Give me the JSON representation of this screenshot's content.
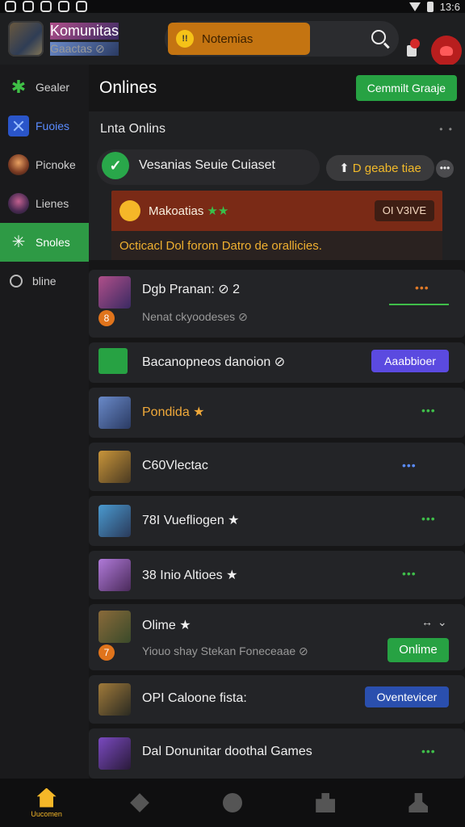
{
  "status": {
    "time": "13:6"
  },
  "header": {
    "app_name": "Komunitas",
    "app_sub": "Gaactas ⊘",
    "notif_label": "Notemias",
    "notif_icon": "!!"
  },
  "sidebar": {
    "items": [
      {
        "label": "Gealer",
        "icon": "star-icon"
      },
      {
        "label": "Fuoies",
        "icon": "cross-icon"
      },
      {
        "label": "Picnoke",
        "icon": "avatar-icon"
      },
      {
        "label": "Lienes",
        "icon": "avatar-icon"
      },
      {
        "label": "Snoles",
        "icon": "leaf-icon"
      },
      {
        "label": "bline",
        "icon": "circle-icon"
      }
    ]
  },
  "main": {
    "title": "Onlines",
    "cta_label": "Cemmilt Graaje",
    "list_header": "Lnta Onlins",
    "verified_row": {
      "text": "Vesanias Seuie Cuiaset",
      "check": "✓",
      "badge": "D geabe tiae",
      "badge_icon": "⬆"
    },
    "warning": {
      "title": "Makoatias",
      "stars": "★★",
      "button": "OI V3IVE",
      "message": "Octicacl Dol forom Datro de orallicies."
    },
    "cards": [
      {
        "title": "Dgb Pranan: ⊘ 2",
        "sub": "Nenat ckyoodeses ⊘",
        "badge": "8",
        "dots": "•••"
      },
      {
        "title": "Bacanopneos danoion ⊘",
        "button": "Aaabbioer"
      },
      {
        "title": "Pondida ★",
        "dots": "•••"
      },
      {
        "title": "C60Vlectac",
        "dots": "•••"
      },
      {
        "title": "78I Vuefliogen ★",
        "dots": "•••"
      },
      {
        "title": "38 Inio Altioes ★",
        "dots": "•••"
      },
      {
        "title": "Olime ★",
        "sub": "Yiouo shay Stekan Foneceaae ⊘",
        "button": "Onlime",
        "badge": "7",
        "dots": "↔ ⌄"
      },
      {
        "title": "OPI Caloone fista:",
        "button": "Oventevicer"
      },
      {
        "title": "Dal Donunitar doothal Games",
        "dots": "•••"
      }
    ]
  },
  "nav": {
    "home_label": "Uucomen"
  },
  "colors": {
    "accent": "#2e9a45",
    "warning": "#7a2a16",
    "brand": "#f5b728"
  }
}
